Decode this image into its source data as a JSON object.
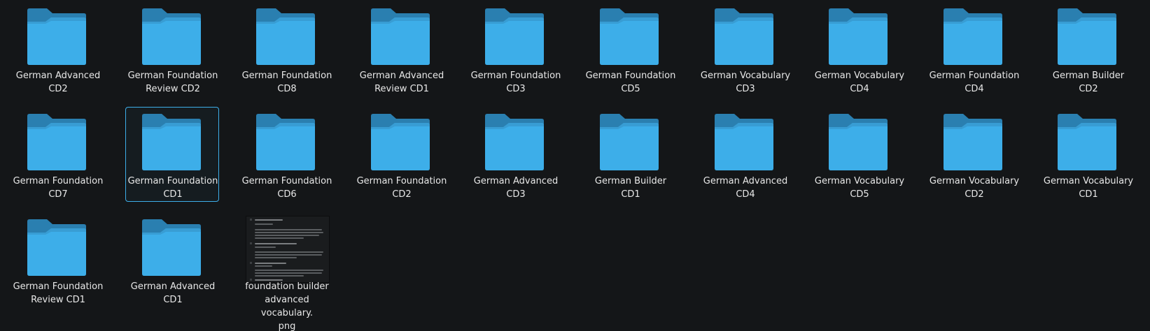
{
  "folder_colors": {
    "body": "#3daee9",
    "tab": "#2a7fb0",
    "shade": "#348fc2"
  },
  "selection_color": "#3daee9",
  "items": [
    {
      "type": "folder",
      "icon": "folder-icon",
      "lines": [
        "German Advanced",
        "CD2"
      ],
      "selected": false
    },
    {
      "type": "folder",
      "icon": "folder-icon",
      "lines": [
        "German Foundation",
        "Review CD2"
      ],
      "selected": false
    },
    {
      "type": "folder",
      "icon": "folder-icon",
      "lines": [
        "German Foundation",
        "CD8"
      ],
      "selected": false
    },
    {
      "type": "folder",
      "icon": "folder-icon",
      "lines": [
        "German Advanced",
        "Review CD1"
      ],
      "selected": false
    },
    {
      "type": "folder",
      "icon": "folder-icon",
      "lines": [
        "German Foundation",
        "CD3"
      ],
      "selected": false
    },
    {
      "type": "folder",
      "icon": "folder-icon",
      "lines": [
        "German Foundation",
        "CD5"
      ],
      "selected": false
    },
    {
      "type": "folder",
      "icon": "folder-icon",
      "lines": [
        "German Vocabulary",
        "CD3"
      ],
      "selected": false
    },
    {
      "type": "folder",
      "icon": "folder-icon",
      "lines": [
        "German Vocabulary",
        "CD4"
      ],
      "selected": false
    },
    {
      "type": "folder",
      "icon": "folder-icon",
      "lines": [
        "German Foundation",
        "CD4"
      ],
      "selected": false
    },
    {
      "type": "folder",
      "icon": "folder-icon",
      "lines": [
        "German Builder CD2"
      ],
      "selected": false
    },
    {
      "type": "folder",
      "icon": "folder-icon",
      "lines": [
        "German Foundation",
        "CD7"
      ],
      "selected": false
    },
    {
      "type": "folder",
      "icon": "folder-icon",
      "lines": [
        "German Foundation",
        "CD1"
      ],
      "selected": true
    },
    {
      "type": "folder",
      "icon": "folder-icon",
      "lines": [
        "German Foundation",
        "CD6"
      ],
      "selected": false
    },
    {
      "type": "folder",
      "icon": "folder-icon",
      "lines": [
        "German Foundation",
        "CD2"
      ],
      "selected": false
    },
    {
      "type": "folder",
      "icon": "folder-icon",
      "lines": [
        "German Advanced",
        "CD3"
      ],
      "selected": false
    },
    {
      "type": "folder",
      "icon": "folder-icon",
      "lines": [
        "German Builder CD1"
      ],
      "selected": false
    },
    {
      "type": "folder",
      "icon": "folder-icon",
      "lines": [
        "German Advanced",
        "CD4"
      ],
      "selected": false
    },
    {
      "type": "folder",
      "icon": "folder-icon",
      "lines": [
        "German Vocabulary",
        "CD5"
      ],
      "selected": false
    },
    {
      "type": "folder",
      "icon": "folder-icon",
      "lines": [
        "German Vocabulary",
        "CD2"
      ],
      "selected": false
    },
    {
      "type": "folder",
      "icon": "folder-icon",
      "lines": [
        "German Vocabulary",
        "CD1"
      ],
      "selected": false
    },
    {
      "type": "folder",
      "icon": "folder-icon",
      "lines": [
        "German Foundation",
        "Review CD1"
      ],
      "selected": false
    },
    {
      "type": "folder",
      "icon": "folder-icon",
      "lines": [
        "German Advanced",
        "CD1"
      ],
      "selected": false
    },
    {
      "type": "image",
      "icon": "image-thumbnail",
      "lines": [
        "foundation builder",
        "advanced vocabulary.",
        "png"
      ],
      "selected": false
    }
  ]
}
